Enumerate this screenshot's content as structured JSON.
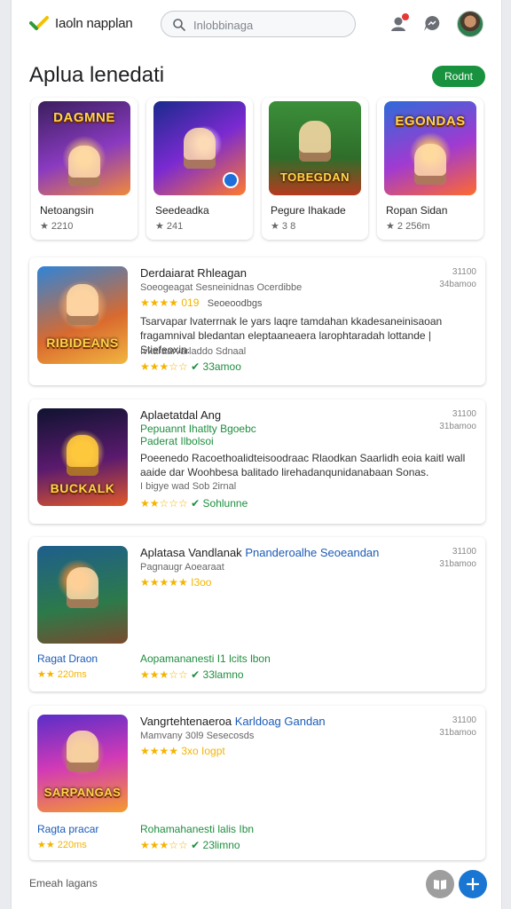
{
  "app": {
    "brand": "Iaoln napplan"
  },
  "search": {
    "placeholder": "Inlobbinaga"
  },
  "header": {
    "title": "Aplua lenedati",
    "action_label": "Rodnt"
  },
  "featured": [
    {
      "title": "Netoangsin",
      "meta": "★ 2210",
      "art_text": "DAGMNE"
    },
    {
      "title": "Seedeadka",
      "meta": "★ 241",
      "art_text": ""
    },
    {
      "title": "Pegure Ihakade",
      "meta": "★ 3 8",
      "art_text": "TOBEGDAN"
    },
    {
      "title": "Ropan Sidan",
      "meta": "★ 2 256m",
      "art_text": "EGONDAS"
    }
  ],
  "cards": [
    {
      "title": "Derdaiarat Rhleagan",
      "subtitle": "Soeogeagat Sesneinidnas Ocerdibbe",
      "stars_label": "★★★★ 019",
      "stars_extra": "Seoeoodbgs",
      "description": "Tsarvapar lvaterrnak le yars laqre tamdahan kkadesaneinisaoan fragamnival bledantan eleptaaneaera larophtaradah lottande | Stiefeoxin.",
      "meta": "Ivkaraarvarladdo Sdnaal",
      "rating": "★★★☆☆",
      "installs": "✔ 33amoo",
      "side": "31100\n34bamoo",
      "art_text": "RIBIDEANS"
    },
    {
      "title": "Aplaetatdal Ang",
      "green1": "Pepuannt Ihatlty Bgoebc",
      "green2": "Paderat Ilbolsoi",
      "description": "Poeenedo Racoethoalidteisoodraac Rlaodkan Saarlidh eoia kaitl wall aaide dar Woohbesa balitado lirehadanqunidanabaan Sonas.",
      "meta": "I bigye wad Sob 2irnal",
      "rating": "★★☆☆☆",
      "installs": "✔ Sohlunne",
      "side": "31100\n31bamoo",
      "art_text": "BUCKALK"
    },
    {
      "title": "Aplatasa Vandlanak",
      "title_link": "Pnanderoalhe Seoeandan",
      "subtitle": "Pagnaugr Aoearaat",
      "stars_label": "★★★★★ I3oo",
      "left_label": "Ragat Draon",
      "left_rating": "★★ 220ms",
      "green_label": "Aopamananesti I1 lcits lbon",
      "rating": "★★★☆☆",
      "installs": "✔ 33lamno",
      "side": "31100\n31bamoo",
      "art_text": ""
    },
    {
      "title": "Vangrtehtenaeroa",
      "title_link": "Karldoag Gandan",
      "subtitle": "Mamvany 30l9 Sesecosds",
      "stars_label": "★★★★ 3xo Iogpt",
      "left_label": "Ragta pracar",
      "left_rating": "★★ 220ms",
      "green_label": "Rohamahanesti lalis Ibn",
      "rating": "★★★☆☆",
      "installs": "✔ 23limno",
      "side": "31100\n31bamoo",
      "art_text": "SARPANGAS"
    }
  ],
  "footer": {
    "text": "Emeah lagans"
  }
}
